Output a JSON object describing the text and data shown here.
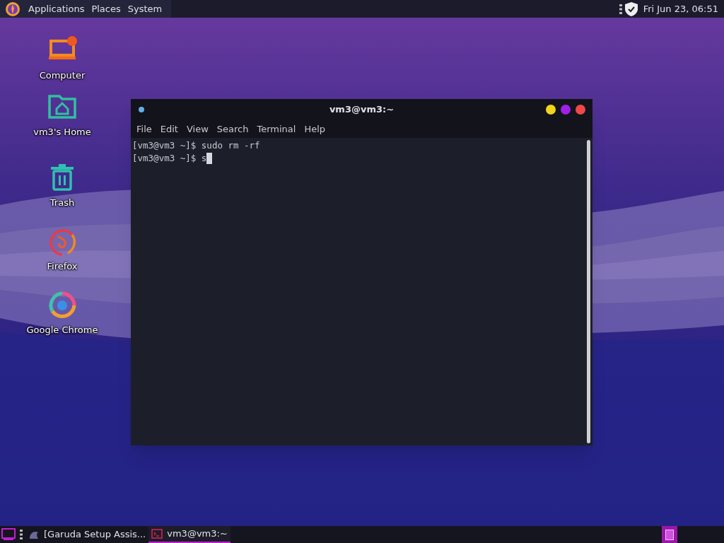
{
  "top_panel": {
    "menus": [
      "Applications",
      "Places",
      "System"
    ],
    "clock": "Fri Jun 23, 06:51"
  },
  "desktop_icons": [
    {
      "kind": "computer",
      "label": "Computer"
    },
    {
      "kind": "home",
      "label": "vm3's Home"
    },
    {
      "kind": "trash",
      "label": "Trash"
    },
    {
      "kind": "firefox",
      "label": "Firefox"
    },
    {
      "kind": "chrome",
      "label": "Google Chrome"
    }
  ],
  "terminal": {
    "title": "vm3@vm3:~",
    "menu": [
      "File",
      "Edit",
      "View",
      "Search",
      "Terminal",
      "Help"
    ],
    "lines": [
      {
        "prompt": "[vm3@vm3 ~]$",
        "command": "sudo rm -rf",
        "cursor": false
      },
      {
        "prompt": "[vm3@vm3 ~]$",
        "command": "s",
        "cursor": true
      }
    ]
  },
  "taskbar": {
    "tasks": [
      {
        "kind": "setup",
        "label": "[Garuda Setup Assis...",
        "selected": false
      },
      {
        "kind": "terminal",
        "label": "vm3@vm3:~",
        "selected": true
      }
    ],
    "workspaces": [
      {
        "selected": true
      }
    ]
  }
}
